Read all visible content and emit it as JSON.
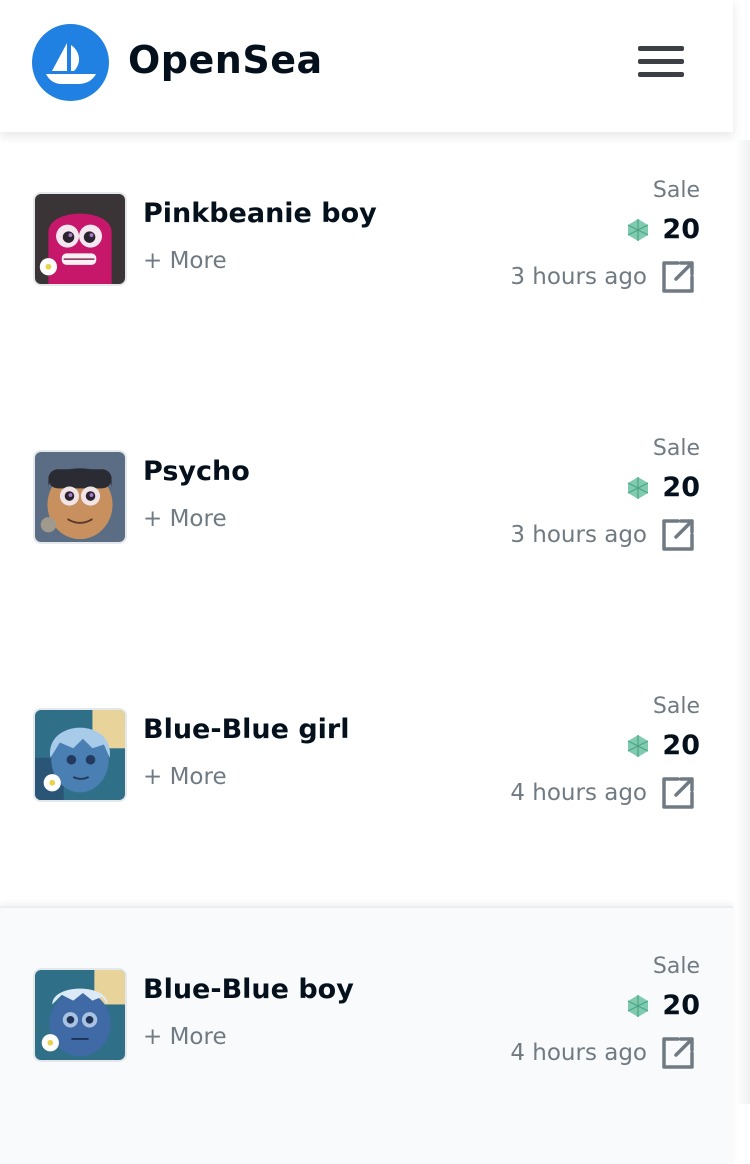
{
  "header": {
    "brand": "OpenSea",
    "colors": {
      "brand_blue": "#2081e2",
      "text": "#04111d",
      "muted": "#707a83"
    }
  },
  "items": [
    {
      "name": "Pinkbeanie boy",
      "more": "+ More",
      "event": "Sale",
      "price": "20",
      "time": "3 hours ago"
    },
    {
      "name": "Psycho",
      "more": "+ More",
      "event": "Sale",
      "price": "20",
      "time": "3 hours ago"
    },
    {
      "name": "Blue-Blue girl",
      "more": "+ More",
      "event": "Sale",
      "price": "20",
      "time": "4 hours ago"
    },
    {
      "name": "Blue-Blue boy",
      "more": "+ More",
      "event": "Sale",
      "price": "20",
      "time": "4 hours ago"
    }
  ],
  "icons": {
    "logo": "opensea-boat-icon",
    "menu": "hamburger-menu-icon",
    "currency": "klay-token-icon",
    "external": "external-link-icon"
  }
}
